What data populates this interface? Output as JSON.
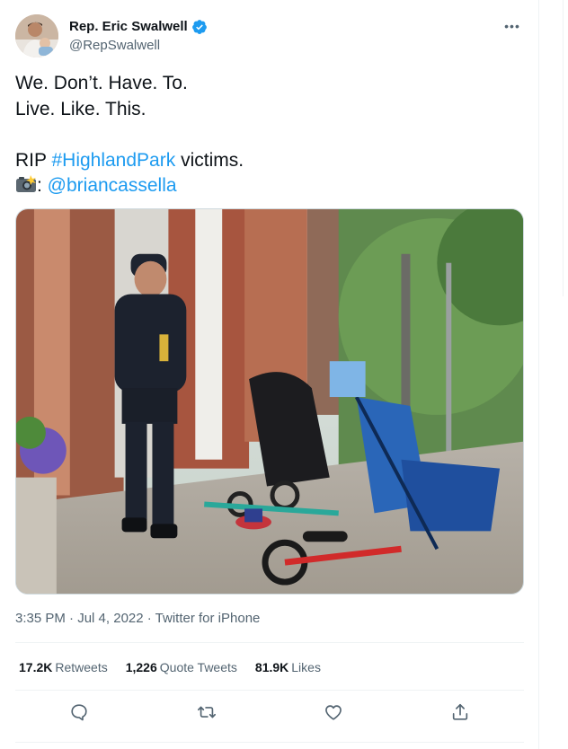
{
  "author": {
    "display_name": "Rep. Eric Swalwell",
    "handle": "@RepSwalwell"
  },
  "tweet": {
    "line1": "We. Don’t. Have. To.",
    "line2": "Live. Like. This.",
    "line3_prefix": "RIP ",
    "hashtag": "#HighlandPark",
    "line3_suffix": " victims.",
    "line4_colon": ": ",
    "mention": "@briancassella"
  },
  "meta": {
    "time": "3:35 PM",
    "separator": " · ",
    "date": "Jul 4, 2022",
    "source": "Twitter for iPhone"
  },
  "stats": {
    "retweets_count": "17.2K",
    "retweets_label": "Retweets",
    "quotes_count": "1,226",
    "quotes_label": "Quote Tweets",
    "likes_count": "81.9K",
    "likes_label": "Likes"
  },
  "colors": {
    "link": "#1d9bf0",
    "verified": "#1d9bf0",
    "secondary_text": "#536471",
    "primary_text": "#0f1419"
  },
  "icons": {
    "more": "more-dots-icon",
    "verified": "verified-badge-icon",
    "camera": "camera-flash-emoji",
    "reply": "reply-bubble-icon",
    "retweet": "retweet-icon",
    "like": "heart-icon",
    "share": "share-icon"
  }
}
